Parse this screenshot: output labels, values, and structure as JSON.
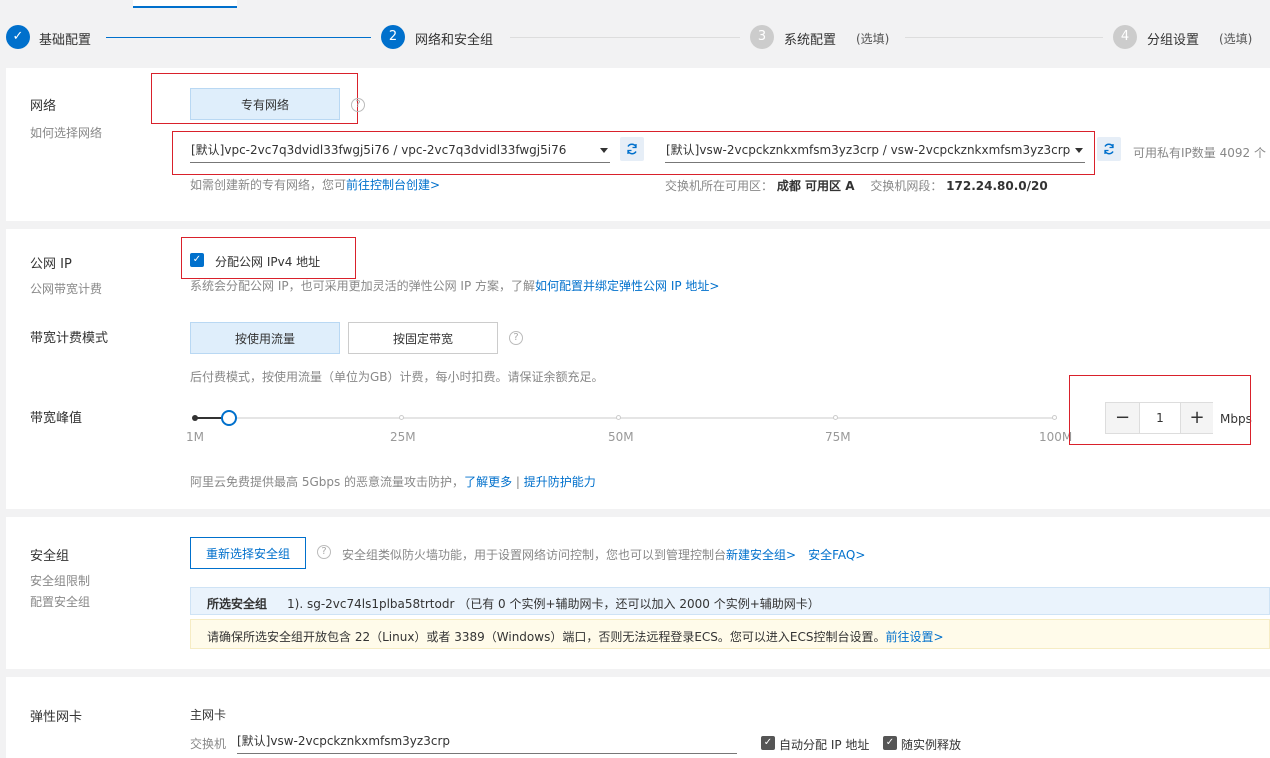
{
  "steps": [
    {
      "index": "✓",
      "label": "基础配置",
      "optional": ""
    },
    {
      "index": "2",
      "label": "网络和安全组",
      "optional": ""
    },
    {
      "index": "3",
      "label": "系统配置",
      "optional": "(选填)"
    },
    {
      "index": "4",
      "label": "分组设置",
      "optional": "(选填)"
    }
  ],
  "network": {
    "title": "网络",
    "subtitle": "如何选择网络",
    "type_button": "专有网络",
    "vpc_select": "[默认]vpc-2vc7q3dvidl33fwgj5i76 / vpc-2vc7q3dvidl33fwgj5i76",
    "vsw_select": "[默认]vsw-2vcpckznkxmfsm3yz3crp / vsw-2vcpckznkxmfsm3yz3crp",
    "ip_count": "可用私有IP数量 4092 个",
    "create_hint": "如需创建新的专有网络，您可",
    "create_link": "前往控制台创建>",
    "zone_label": "交换机所在可用区：",
    "zone_value": "成都 可用区 A",
    "cidr_label": "交换机网段：",
    "cidr_value": "172.24.80.0/20"
  },
  "public_ip": {
    "title": "公网 IP",
    "subtitle": "公网带宽计费",
    "checkbox_label": "分配公网 IPv4 地址",
    "hint": "系统会分配公网 IP，也可采用更加灵活的弹性公网 IP 方案，了解",
    "hint_link": "如何配置并绑定弹性公网 IP 地址>",
    "billing_title": "带宽计费模式",
    "billing_traffic": "按使用流量",
    "billing_fixed": "按固定带宽",
    "billing_hint": "后付费模式，按使用流量（单位为GB）计费，每小时扣费。请保证余额充足。",
    "peak_title": "带宽峰值",
    "slider_ticks": [
      "1M",
      "25M",
      "50M",
      "75M",
      "100M"
    ],
    "slider_value": 1,
    "slider_max": 100,
    "stepper_minus": "−",
    "stepper_value": "1",
    "stepper_plus": "+",
    "stepper_unit": "Mbps",
    "ddos_hint": "阿里云免费提供最高 5Gbps 的恶意流量攻击防护，",
    "ddos_link1": "了解更多",
    "ddos_sep": " | ",
    "ddos_link2": "提升防护能力"
  },
  "security_group": {
    "title": "安全组",
    "subtitle1": "安全组限制",
    "subtitle2": "配置安全组",
    "reselect_button": "重新选择安全组",
    "hint": "安全组类似防火墙功能，用于设置网络访问控制，您也可以到管理控制台",
    "new_link": "新建安全组>",
    "faq_link": "安全FAQ>",
    "selected_label": "所选安全组",
    "selected_value": "1). sg-2vc74ls1plba58trtodr （已有 0 个实例+辅助网卡，还可以加入 2000 个实例+辅助网卡）",
    "warning": "请确保所选安全组开放包含 22（Linux）或者 3389（Windows）端口，否则无法远程登录ECS。您可以进入ECS控制台设置。",
    "warning_link": "前往设置>"
  },
  "eni": {
    "title": "弹性网卡",
    "primary": "主网卡",
    "switch_label": "交换机",
    "switch_value": "[默认]vsw-2vcpckznkxmfsm3yz3crp",
    "auto_ip": "自动分配 IP 地址",
    "release": "随实例释放"
  },
  "colors": {
    "accent": "#0070cc",
    "highlight_red": "#d9212b"
  }
}
